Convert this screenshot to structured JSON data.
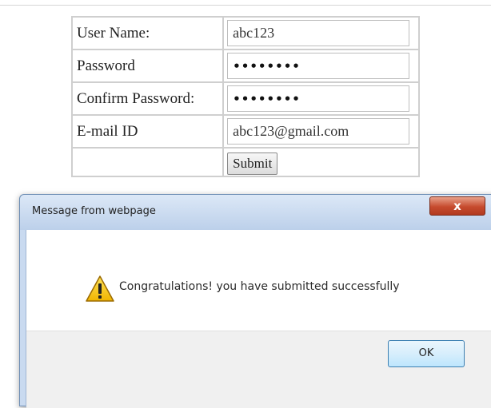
{
  "form": {
    "rows": [
      {
        "label": "User Name:",
        "value": "abc123",
        "type": "text"
      },
      {
        "label": "Password",
        "value": "••••••••",
        "type": "password"
      },
      {
        "label": "Confirm Password:",
        "value": "••••••••",
        "type": "password"
      },
      {
        "label": "E-mail ID",
        "value": "abc123@gmail.com",
        "type": "text"
      }
    ],
    "submit_label": "Submit"
  },
  "dialog": {
    "title": "Message from webpage",
    "close_label": "x",
    "message": "Congratulations! you have submitted successfully",
    "ok_label": "OK",
    "icon": "warning-icon"
  },
  "colors": {
    "dialog_frame": "#c9daf0",
    "close_button": "#c64b2e",
    "ok_border": "#3c7fb1",
    "warning_yellow": "#f5c400"
  }
}
